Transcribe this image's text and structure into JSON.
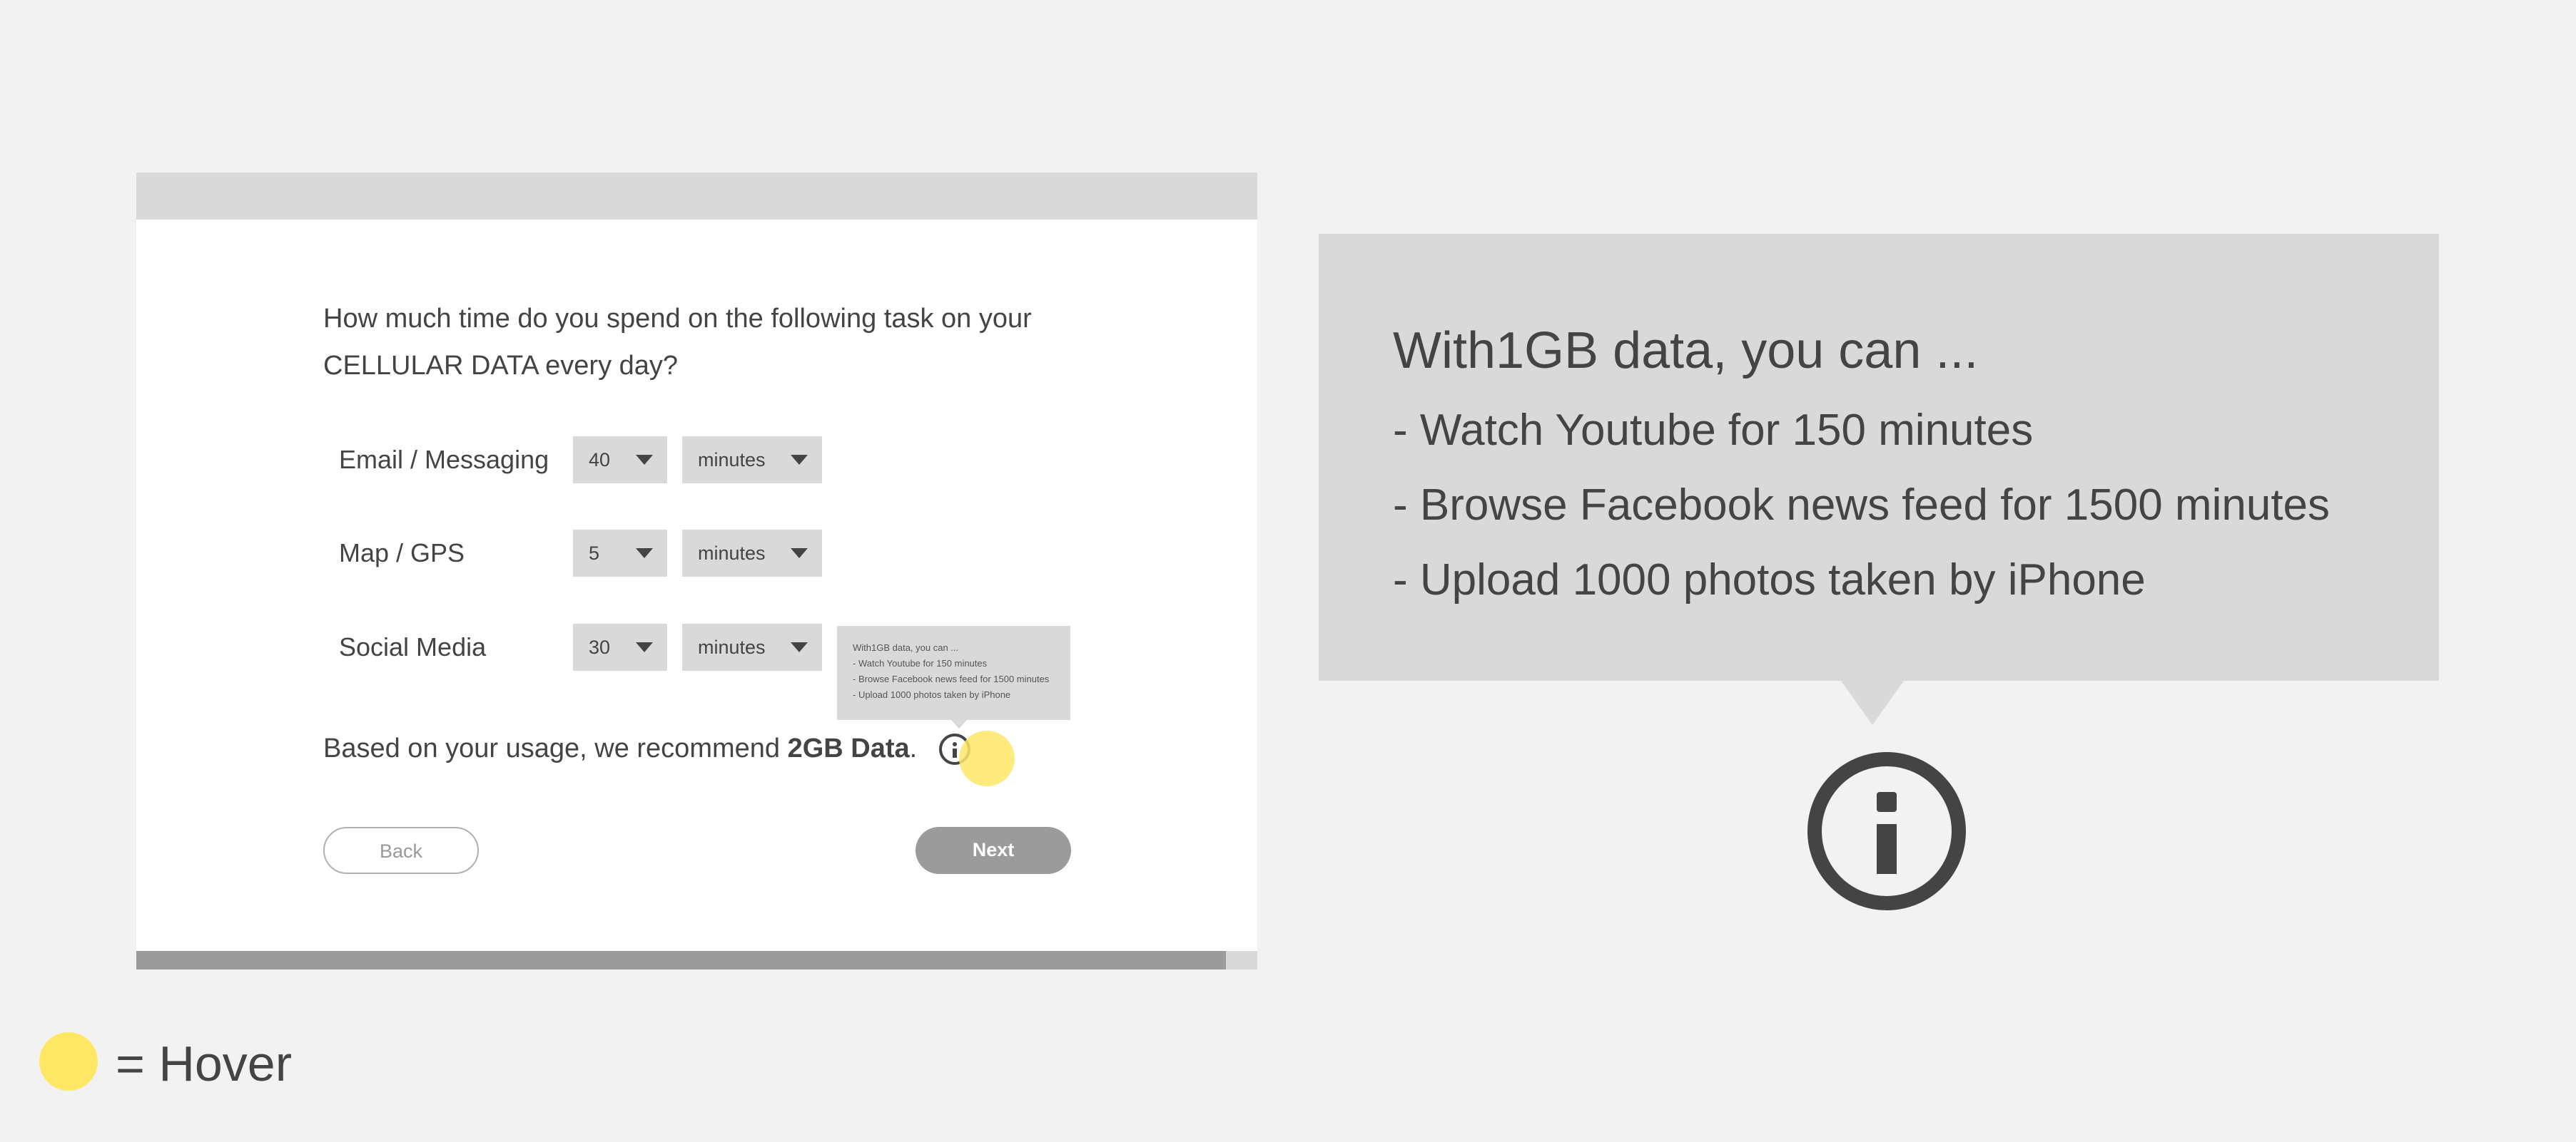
{
  "survey": {
    "question_line1": "How much time do you spend on the following task on your",
    "question_line2": "CELLULAR DATA every day?",
    "rows": [
      {
        "label": "Email / Messaging",
        "amount": "40",
        "unit": "minutes"
      },
      {
        "label": "Map / GPS",
        "amount": "5",
        "unit": "minutes"
      },
      {
        "label": "Social Media",
        "amount": "30",
        "unit": "minutes"
      }
    ],
    "recommend_prefix": "Based on your usage, we recommend ",
    "recommend_value": "2GB Data",
    "recommend_suffix": ".",
    "back_label": "Back",
    "next_label": "Next",
    "progress": 0.972
  },
  "tooltip": {
    "title": "With1GB data, you can ...",
    "lines": [
      "- Watch Youtube for 150 minutes",
      "- Browse Facebook news feed for 1500 minutes",
      "- Upload 1000 photos taken by iPhone"
    ]
  },
  "legend": {
    "label": "= Hover",
    "hover_color": "#ffe766"
  },
  "icons": {
    "info": "info-icon",
    "dropdown": "caret-down-icon"
  }
}
